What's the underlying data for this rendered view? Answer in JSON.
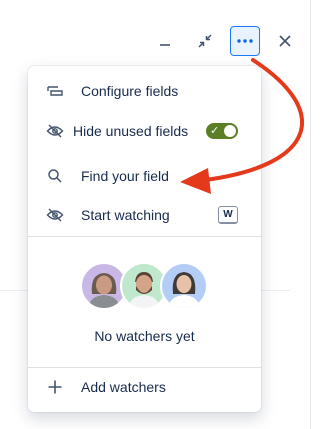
{
  "toolbar": {
    "buttons": [
      {
        "name": "minimize",
        "icon": "minimize-icon"
      },
      {
        "name": "shrink",
        "icon": "shrink-icon"
      },
      {
        "name": "more",
        "icon": "more-horizontal-icon",
        "active": true
      },
      {
        "name": "close",
        "icon": "close-icon"
      }
    ]
  },
  "menu": {
    "items": [
      {
        "label": "Configure fields",
        "icon": "configure-icon"
      },
      {
        "label": "Hide unused fields",
        "icon": "eye-off-icon",
        "toggle_on": true
      },
      {
        "label": "Find your field",
        "icon": "search-icon"
      },
      {
        "label": "Start watching",
        "icon": "eye-off-icon",
        "shortcut": "W"
      }
    ],
    "watchers": {
      "empty_text": "No watchers yet",
      "avatars": [
        "avatar-woman",
        "avatar-man-beard",
        "avatar-woman-2"
      ]
    },
    "add_watchers": {
      "label": "Add watchers",
      "icon": "plus-icon"
    }
  },
  "colors": {
    "accent_blue": "#1d7afc",
    "toggle_green": "#5b7f24",
    "annotation_red": "#e5391b",
    "text": "#172b4d"
  }
}
